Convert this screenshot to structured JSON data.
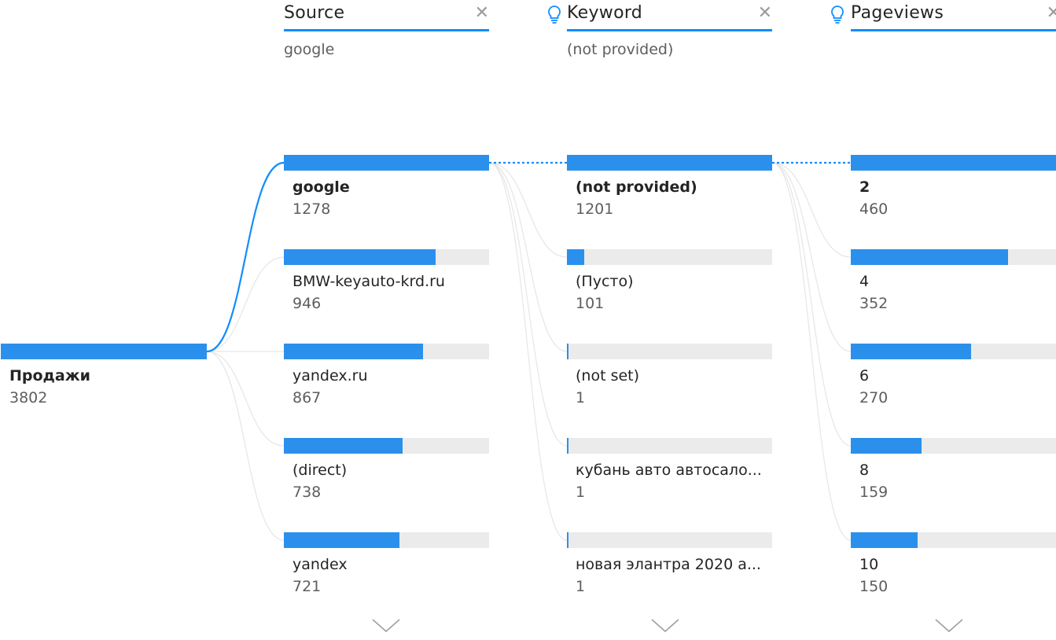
{
  "root": {
    "label": "Продажи",
    "value": "3802",
    "fill": 1.0
  },
  "levels": [
    {
      "title": "Source",
      "selected": "google",
      "has_ai_icon": false,
      "nodes": [
        {
          "label": "google",
          "value": "1278",
          "fill": 1.0,
          "selected": true
        },
        {
          "label": "BMW-keyauto-krd.ru",
          "value": "946",
          "fill": 0.74
        },
        {
          "label": "yandex.ru",
          "value": "867",
          "fill": 0.68
        },
        {
          "label": "(direct)",
          "value": "738",
          "fill": 0.58
        },
        {
          "label": "yandex",
          "value": "721",
          "fill": 0.565
        }
      ]
    },
    {
      "title": "Keyword",
      "selected": "(not provided)",
      "has_ai_icon": true,
      "nodes": [
        {
          "label": "(not provided)",
          "value": "1201",
          "fill": 1.0,
          "selected": true
        },
        {
          "label": "(Пусто)",
          "value": "101",
          "fill": 0.085
        },
        {
          "label": "(not set)",
          "value": "1",
          "fill": 0.004
        },
        {
          "label": "кубань авто автосало...",
          "value": "1",
          "fill": 0.004
        },
        {
          "label": "новая элантра 2020 а...",
          "value": "1",
          "fill": 0.004
        }
      ]
    },
    {
      "title": "Pageviews",
      "selected": "",
      "has_ai_icon": true,
      "nodes": [
        {
          "label": "2",
          "value": "460",
          "fill": 1.0,
          "selected": true
        },
        {
          "label": "4",
          "value": "352",
          "fill": 0.765
        },
        {
          "label": "6",
          "value": "270",
          "fill": 0.587
        },
        {
          "label": "8",
          "value": "159",
          "fill": 0.346
        },
        {
          "label": "10",
          "value": "150",
          "fill": 0.326
        }
      ]
    }
  ],
  "icons": {
    "close": "close-icon",
    "bulb": "lightbulb-icon",
    "more": "chevron-down-icon"
  },
  "colors": {
    "accent": "#118DFF",
    "bar": "#2B90EC",
    "track": "#EBEBEB",
    "connector_inactive": "#E6E6E6"
  }
}
